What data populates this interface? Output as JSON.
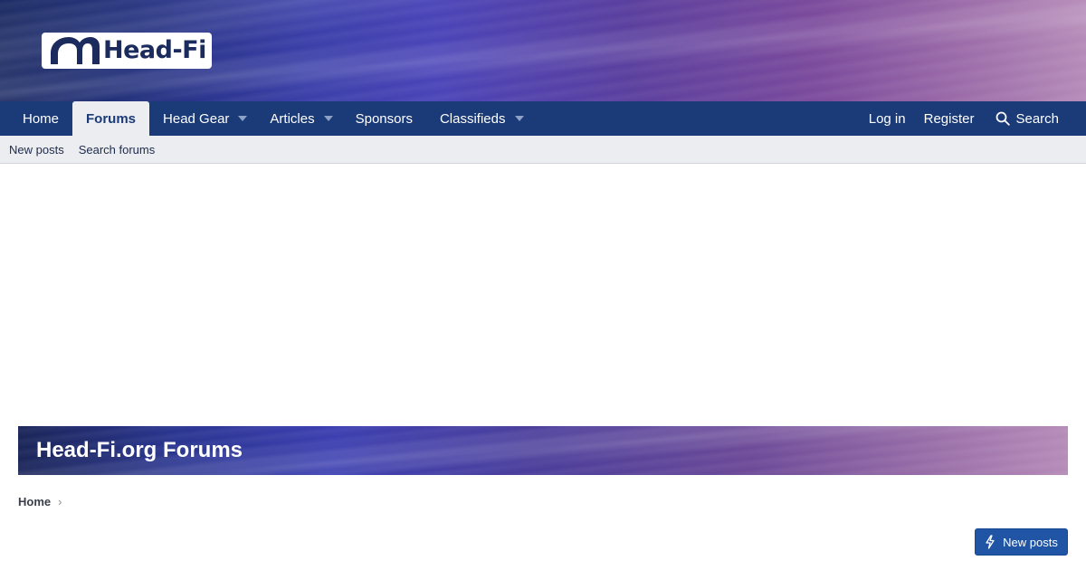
{
  "header": {
    "logo_text": "Head-Fi"
  },
  "nav": {
    "items": [
      {
        "label": "Home",
        "has_caret": false,
        "active": false
      },
      {
        "label": "Forums",
        "has_caret": false,
        "active": true
      },
      {
        "label": "Head Gear",
        "has_caret": true,
        "active": false
      },
      {
        "label": "Articles",
        "has_caret": true,
        "active": false
      },
      {
        "label": "Sponsors",
        "has_caret": false,
        "active": false
      },
      {
        "label": "Classifieds",
        "has_caret": true,
        "active": false
      }
    ],
    "login_label": "Log in",
    "register_label": "Register",
    "search_label": "Search"
  },
  "subnav": {
    "items": [
      {
        "label": "New posts"
      },
      {
        "label": "Search forums"
      }
    ]
  },
  "page": {
    "title": "Head-Fi.org Forums"
  },
  "breadcrumb": {
    "home_label": "Home",
    "separator": "›"
  },
  "actions": {
    "new_posts_label": "New posts"
  },
  "colors": {
    "nav_bar": "#1a3a78",
    "subnav_bg": "#ecedf0",
    "button_primary": "#1f55a4"
  },
  "icons": {
    "search": "search-icon",
    "caret": "caret-down-icon",
    "new_posts": "bolt-icon",
    "breadcrumb_sep": "chevron-right-icon"
  }
}
